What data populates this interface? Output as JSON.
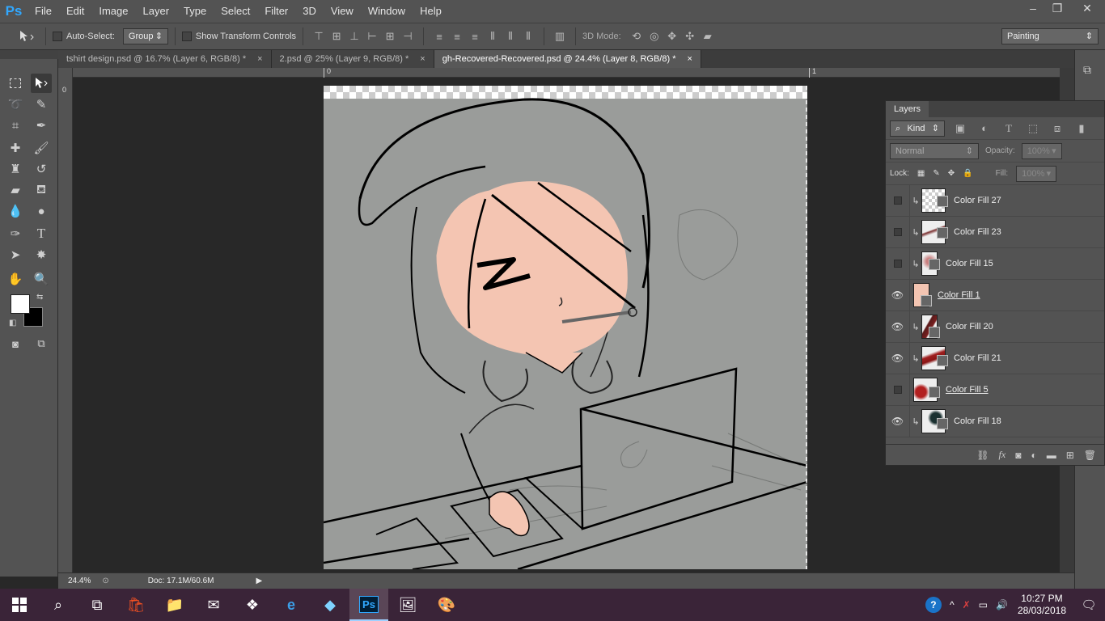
{
  "app": {
    "logo": "Ps"
  },
  "menu": [
    "File",
    "Edit",
    "Image",
    "Layer",
    "Type",
    "Select",
    "Filter",
    "3D",
    "View",
    "Window",
    "Help"
  ],
  "window_controls": {
    "minimize": "–",
    "restore": "❐",
    "close": "✕"
  },
  "options": {
    "auto_select_label": "Auto-Select:",
    "auto_select_value": "Group",
    "show_transform_label": "Show Transform Controls",
    "mode3d_label": "3D Mode:",
    "workspace": "Painting"
  },
  "tabs": [
    {
      "label": "tshirt design.psd @ 16.7% (Layer 6, RGB/8) *",
      "close": "×"
    },
    {
      "label": "2.psd @ 25% (Layer 9, RGB/8) *",
      "close": "×"
    },
    {
      "label": "gh-Recovered-Recovered.psd @ 24.4% (Layer 8, RGB/8) *",
      "close": "×"
    }
  ],
  "rulers": {
    "top_0": "0",
    "top_1": "1",
    "left_0": "0"
  },
  "status": {
    "zoom": "24.4%",
    "doc": "Doc: 17.1M/60.6M"
  },
  "layers_panel": {
    "title": "Layers",
    "kind": "Kind",
    "blend": "Normal",
    "opacity_label": "Opacity:",
    "opacity_value": "100%",
    "lock_label": "Lock:",
    "fill_label": "Fill:",
    "fill_value": "100%",
    "layers": [
      {
        "name": "Color Fill 27",
        "visible": false,
        "clipped": true,
        "underlined": false
      },
      {
        "name": "Color Fill 23",
        "visible": false,
        "clipped": true,
        "underlined": false
      },
      {
        "name": "Color Fill 15",
        "visible": false,
        "clipped": true,
        "underlined": false
      },
      {
        "name": "Color Fill 1",
        "visible": true,
        "clipped": false,
        "underlined": true
      },
      {
        "name": "Color Fill 20",
        "visible": true,
        "clipped": true,
        "underlined": false
      },
      {
        "name": "Color Fill 21",
        "visible": true,
        "clipped": true,
        "underlined": false
      },
      {
        "name": "Color Fill 5",
        "visible": false,
        "clipped": false,
        "underlined": true
      },
      {
        "name": "Color Fill 18",
        "visible": true,
        "clipped": true,
        "underlined": false
      }
    ]
  },
  "taskbar": {
    "time": "10:27 PM",
    "date": "28/03/2018"
  },
  "colors": {
    "ui": "#535353",
    "skin": "#f4c5b2",
    "paper": "#9a9c9a",
    "ps_blue": "#31a8ff"
  }
}
